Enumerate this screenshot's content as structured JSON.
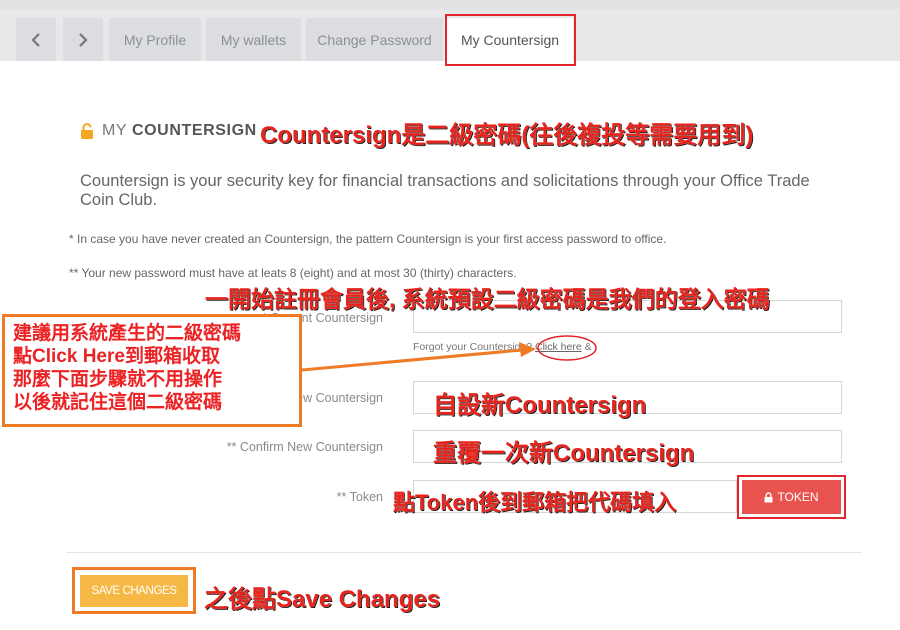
{
  "tabs": {
    "items": [
      "My Profile",
      "My wallets",
      "Change Password",
      "My Countersign"
    ],
    "back_icon": "chevron-left-icon",
    "forward_icon": "chevron-right-icon"
  },
  "section": {
    "title_prefix": "MY",
    "title_strong": "COUNTERSIGN",
    "description": "Countersign is your security key for financial transactions and solicitations through your Office Trade Coin Club.",
    "note1": "* In case you have never created an Countersign, the pattern Countersign is your first access password to office.",
    "note2": "** Your new password must have at leats 8 (eight) and at most 30 (thirty) characters."
  },
  "form": {
    "current_label": "* Current Countersign",
    "forgot_text": "Forgot your Countersign?",
    "click_here": "Click here",
    "forgot_suffix": "&",
    "new_label": "** New Countersign",
    "confirm_label": "** Confirm New Countersign",
    "token_label": "** Token",
    "token_button": "TOKEN",
    "save_button": "SAVE CHANGES"
  },
  "annotations": {
    "title_note": "Countersign是二級密碼(往後複投等需要用到)",
    "default_note": "一開始註冊會員後, 系統預設二級密碼是我們的登入密碼",
    "box_lines": [
      "建議用系統產生的二級密碼",
      "點Click Here到郵箱收取",
      "那麼下面步驟就不用操作",
      "以後就記住這個二級密碼"
    ],
    "new_note": "自設新Countersign",
    "confirm_note": "重覆一次新Countersign",
    "token_note": "點Token後到郵箱把代碼填入",
    "save_note": "之後點Save Changes"
  },
  "colors": {
    "token_button": "#e9534f",
    "save_button": "#f6b845",
    "annotation_red": "#e8231c",
    "annotation_orange_border": "#f07b27",
    "lock_icon": "#f5a623"
  }
}
